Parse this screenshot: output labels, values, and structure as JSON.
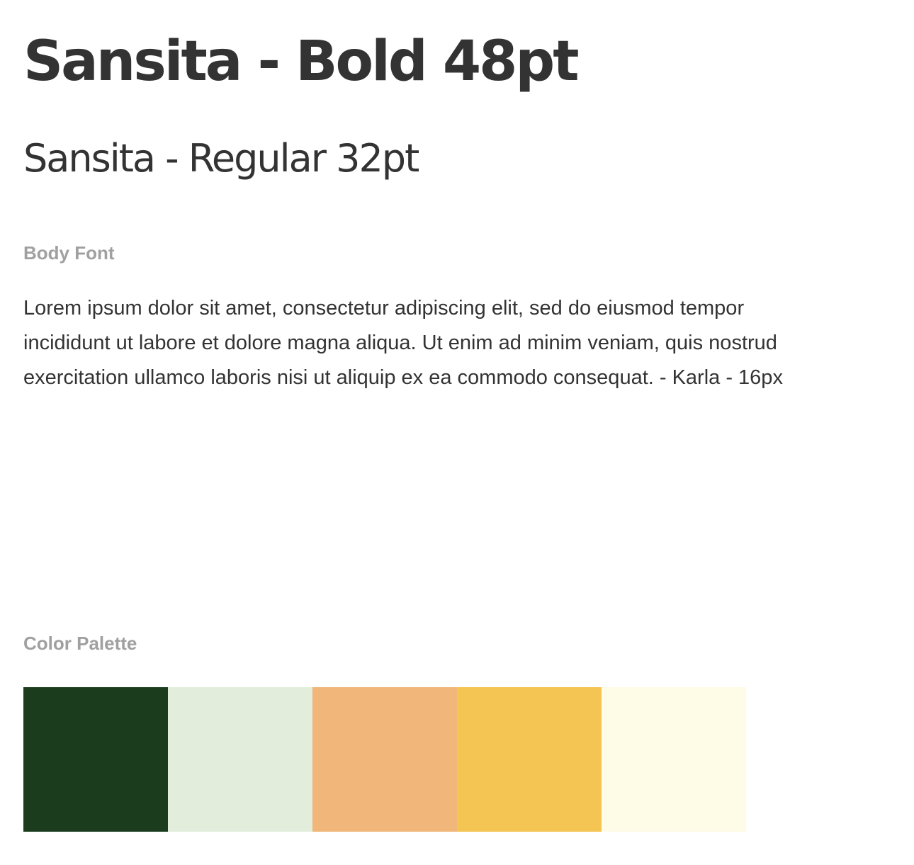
{
  "headings": {
    "bold_sample": "Sansita - Bold 48pt",
    "regular_sample": "Sansita - Regular 32pt"
  },
  "body_font": {
    "label": "Body Font",
    "sample_text": "Lorem ipsum dolor sit amet, consectetur adipiscing elit, sed do eiusmod tempor incididunt ut labore et dolore magna aliqua. Ut enim ad minim veniam, quis nostrud exercitation ullamco laboris nisi ut aliquip ex ea commodo consequat. - Karla - 16px"
  },
  "color_palette": {
    "label": "Color Palette",
    "swatches": [
      "#1b3d1e",
      "#e2eddc",
      "#f0b67a",
      "#f5c553",
      "#fefbe6"
    ]
  },
  "colors": {
    "text_primary": "#333333",
    "text_label": "#a0a0a0",
    "background": "#ffffff"
  }
}
